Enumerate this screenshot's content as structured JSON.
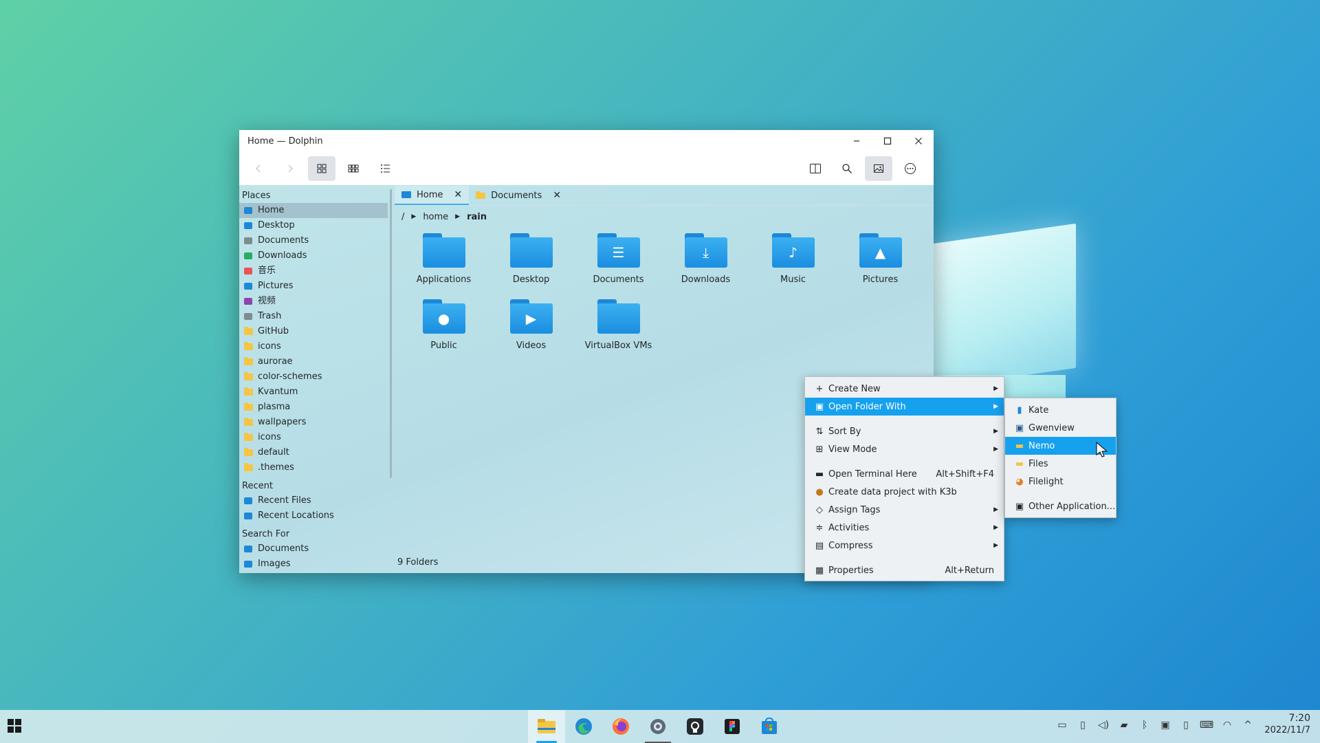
{
  "window": {
    "title": "Home — Dolphin",
    "controls": {
      "minimize": "–",
      "maximize": "□",
      "close": "✕"
    }
  },
  "toolbar": {
    "back": "‹",
    "forward": "›",
    "view_modes": [
      "icons-view",
      "compact-view",
      "details-view"
    ],
    "right_buttons": [
      "split-view",
      "search",
      "preview",
      "menu"
    ]
  },
  "places": {
    "header": "Places",
    "items": [
      {
        "label": "Home",
        "icon": "home-icon",
        "color": "#1d88d8"
      },
      {
        "label": "Desktop",
        "icon": "desktop-icon",
        "color": "#1d88d8"
      },
      {
        "label": "Documents",
        "icon": "documents-icon",
        "color": "#7f8c8d"
      },
      {
        "label": "Downloads",
        "icon": "downloads-icon",
        "color": "#27ae60"
      },
      {
        "label": "音乐",
        "icon": "music-icon",
        "color": "#e95454"
      },
      {
        "label": "Pictures",
        "icon": "pictures-icon",
        "color": "#1d88d8"
      },
      {
        "label": "视频",
        "icon": "video-icon",
        "color": "#8e44ad"
      },
      {
        "label": "Trash",
        "icon": "trash-icon",
        "color": "#7f8c8d"
      },
      {
        "label": "GitHub",
        "icon": "folder-icon",
        "color": "#f6c544"
      },
      {
        "label": "icons",
        "icon": "folder-icon",
        "color": "#f6c544"
      },
      {
        "label": "aurorae",
        "icon": "folder-icon",
        "color": "#f6c544"
      },
      {
        "label": "color-schemes",
        "icon": "folder-icon",
        "color": "#f6c544"
      },
      {
        "label": "Kvantum",
        "icon": "folder-icon",
        "color": "#f6c544"
      },
      {
        "label": "plasma",
        "icon": "folder-icon",
        "color": "#f6c544"
      },
      {
        "label": "wallpapers",
        "icon": "folder-icon",
        "color": "#f6c544"
      },
      {
        "label": "icons",
        "icon": "folder-icon",
        "color": "#f6c544"
      },
      {
        "label": "default",
        "icon": "folder-icon",
        "color": "#f6c544"
      },
      {
        "label": ".themes",
        "icon": "folder-icon",
        "color": "#f6c544"
      }
    ]
  },
  "recent": {
    "header": "Recent",
    "items": [
      {
        "label": "Recent Files",
        "icon": "recent-files-icon"
      },
      {
        "label": "Recent Locations",
        "icon": "recent-locations-icon"
      }
    ]
  },
  "search_for": {
    "header": "Search For",
    "items": [
      {
        "label": "Documents",
        "icon": "documents-icon"
      },
      {
        "label": "Images",
        "icon": "images-icon"
      }
    ]
  },
  "tabs": [
    {
      "label": "Home",
      "close": "✕",
      "active": true
    },
    {
      "label": "Documents",
      "close": "✕",
      "active": false
    }
  ],
  "breadcrumb": {
    "root": "/",
    "parts": [
      "home",
      "rain"
    ]
  },
  "folders": [
    {
      "name": "Applications",
      "glyph": ""
    },
    {
      "name": "Desktop",
      "glyph": ""
    },
    {
      "name": "Documents",
      "glyph": "☰"
    },
    {
      "name": "Downloads",
      "glyph": "⤓"
    },
    {
      "name": "Music",
      "glyph": "♪"
    },
    {
      "name": "Pictures",
      "glyph": "▲"
    },
    {
      "name": "Public",
      "glyph": "●"
    },
    {
      "name": "Videos",
      "glyph": "▶"
    },
    {
      "name": "VirtualBox VMs",
      "glyph": ""
    }
  ],
  "status": "9 Folders",
  "context_menu": {
    "create_new": "Create New",
    "open_with": "Open Folder With",
    "sort_by": "Sort By",
    "view_mode": "View Mode",
    "open_terminal": "Open Terminal Here",
    "open_terminal_shortcut": "Alt+Shift+F4",
    "k3b": "Create data project with K3b",
    "assign_tags": "Assign Tags",
    "activities": "Activities",
    "compress": "Compress",
    "properties": "Properties",
    "properties_shortcut": "Alt+Return"
  },
  "submenu": {
    "kate": "Kate",
    "gwenview": "Gwenview",
    "nemo": "Nemo",
    "files": "Files",
    "filelight": "Filelight",
    "other": "Other Application..."
  },
  "clock": {
    "time": "7:20",
    "date": "2022/11/7"
  },
  "accent": "#16a1ef"
}
